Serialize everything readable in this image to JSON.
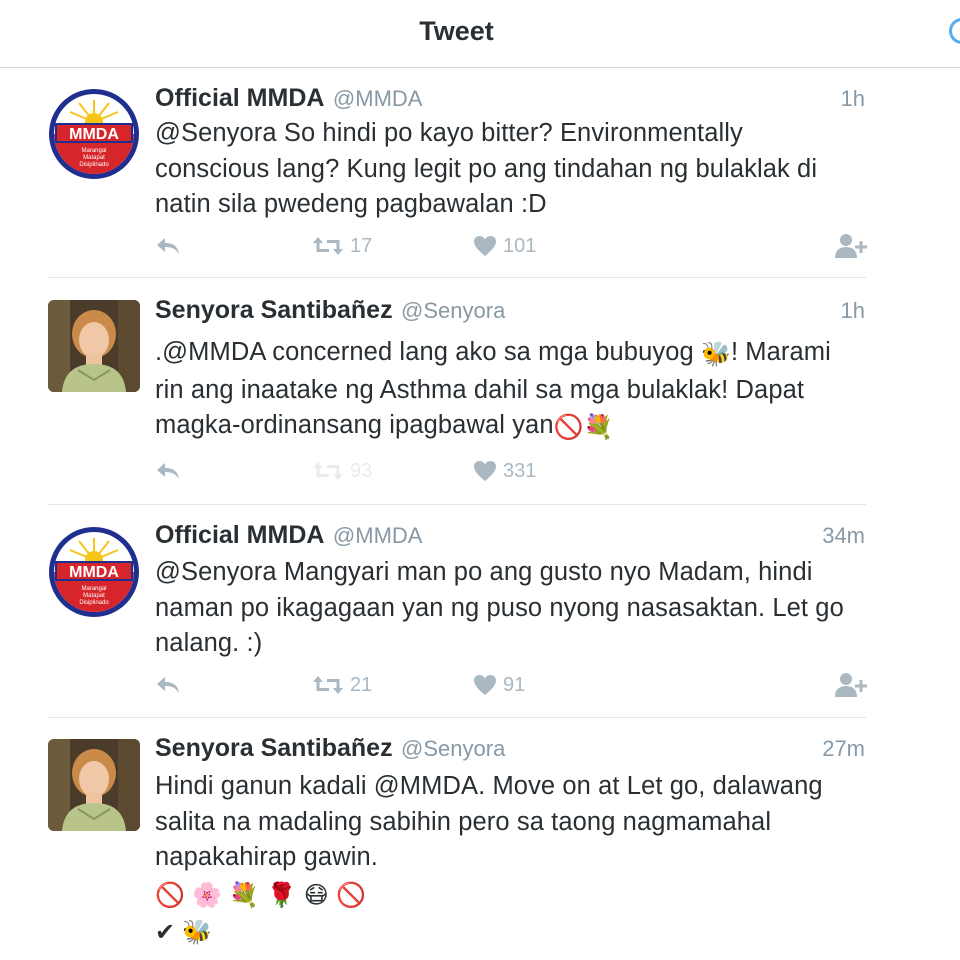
{
  "nav": {
    "title": "Tweet"
  },
  "tweets": [
    {
      "display_name": "Official MMDA",
      "username": "@MMDA",
      "time": "1h",
      "avatar": "mmda-logo",
      "lines": [
        "@Senyora So hindi po kayo bitter? Environmentally",
        "conscious lang? Kung legit po ang tindahan ng bulaklak di",
        "natin sila pwedeng pagbawalan :D"
      ],
      "retweets": "17",
      "likes": "101"
    },
    {
      "display_name": "Senyora Santibañez",
      "username": "@Senyora",
      "time": "1h",
      "avatar": "woman-portrait",
      "line1a": ".@MMDA concerned lang ako sa mga bubuyog ",
      "line1b": "! Marami",
      "line2": "rin ang inaatake ng Asthma dahil sa mga bulaklak! Dapat",
      "line3": "magka-ordinansang ipagbawal yan",
      "emoji_bee": "🐝",
      "emoji_no": "🚫",
      "emoji_bouquet": "💐",
      "retweets": "93",
      "likes": "331"
    },
    {
      "display_name": "Official MMDA",
      "username": "@MMDA",
      "time": "34m",
      "avatar": "mmda-logo",
      "lines": [
        "@Senyora Mangyari man po ang gusto nyo Madam, hindi",
        "naman po ikagagaan yan ng puso nyong nasasaktan. Let go",
        "nalang. :)"
      ],
      "retweets": "21",
      "likes": "91"
    },
    {
      "display_name": "Senyora Santibañez",
      "username": "@Senyora",
      "time": "27m",
      "avatar": "woman-portrait",
      "lines": [
        "Hindi ganun kadali @MMDA. Move on at Let go, dalawang",
        "salita na madaling sabihin pero sa taong nagmamahal",
        "napakahirap gawin."
      ],
      "emoji_row1": [
        "🚫",
        "🌸",
        "💐",
        "🌹",
        "😷",
        "🚫"
      ],
      "emoji_row2": [
        "✔",
        "🐝"
      ]
    }
  ],
  "logo": {
    "text": "MMDA",
    "motto": "Marangal Matapat Disiplinado Atbp.",
    "colors": {
      "blue": "#1f2f8f",
      "red": "#d7262b",
      "yellow": "#f5c518"
    }
  },
  "colors": {
    "text": "#292f33",
    "muted": "#8899a6",
    "icon": "#aab8c2",
    "accent": "#55acee"
  }
}
